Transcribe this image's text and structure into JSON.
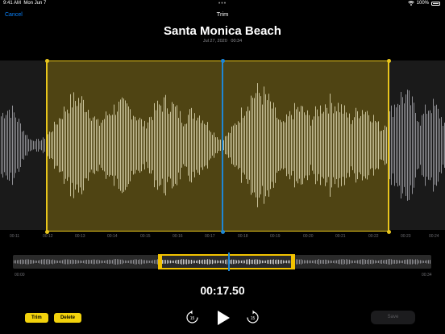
{
  "status": {
    "time": "9:41 AM",
    "date": "Mon Jun 7",
    "battery": "100%"
  },
  "header": {
    "cancel_label": "Cancel",
    "title": "Trim"
  },
  "recording": {
    "title": "Santa Monica Beach",
    "date": "Jul 27, 2020",
    "duration": "00:34"
  },
  "waveform": {
    "ticks": [
      "00:11",
      "00:12",
      "00:13",
      "00:14",
      "00:15",
      "00:16",
      "00:17",
      "00:18",
      "00:19",
      "00:20",
      "00:21",
      "00:22",
      "00:23",
      "00:24"
    ],
    "colors": {
      "selection": "#4f4413",
      "handle": "#e8c51c",
      "playhead": "#1e86d4"
    }
  },
  "overview": {
    "start": "00:00",
    "end": "00:34"
  },
  "playback": {
    "elapsed": "00:17.50",
    "skip_seconds": "15"
  },
  "toolbar": {
    "trim_label": "Trim",
    "delete_label": "Delete",
    "save_label": "Save"
  }
}
